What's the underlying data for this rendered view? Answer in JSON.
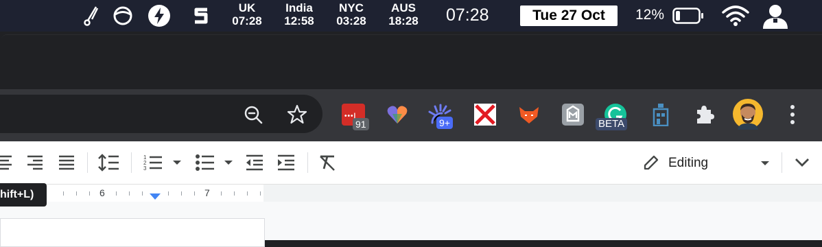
{
  "menubar": {
    "clocks": [
      {
        "label": "UK",
        "time": "07:28"
      },
      {
        "label": "India",
        "time": "12:58"
      },
      {
        "label": "NYC",
        "time": "03:28"
      },
      {
        "label": "AUS",
        "time": "18:28"
      }
    ],
    "time": "07:28",
    "date": "Tue 27 Oct",
    "battery": "12%"
  },
  "extensions": {
    "lastpass_badge": "91",
    "ext3_badge": "9+",
    "grammarly_badge": "BETA"
  },
  "docs": {
    "mode": "Editing",
    "tooltip": "hift+L)",
    "ruler_labels": [
      "6",
      "7"
    ]
  },
  "colors": {
    "menubar_bg": "#1e2231",
    "toolbar_bg": "#35363a",
    "accent_blue": "#4285f4"
  }
}
